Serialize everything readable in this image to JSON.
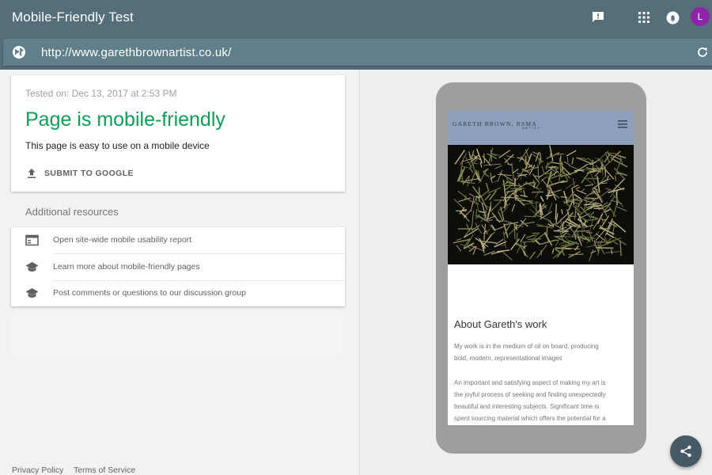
{
  "app": {
    "title": "Mobile-Friendly Test",
    "avatar_letter": "L",
    "icons": [
      "feedback-icon",
      "apps-grid-icon",
      "notifications-icon"
    ],
    "accent_color": "#546e7a",
    "success_color": "#0f9d58"
  },
  "urlbar": {
    "url": "http://www.garethbrownartist.co.uk/",
    "left_icon": "globe-icon",
    "right_icon": "refresh-icon"
  },
  "result": {
    "tested_on": "Tested on: Dec 13, 2017 at 2:53 PM",
    "verdict": "Page is mobile-friendly",
    "description": "This page is easy to use on a mobile device",
    "submit_label": "SUBMIT TO GOOGLE"
  },
  "resources": {
    "title": "Additional resources",
    "items": [
      {
        "label": "Open site-wide mobile usability report",
        "icon": "web-report-icon"
      },
      {
        "label": "Learn more about mobile-friendly pages",
        "icon": "school-icon"
      },
      {
        "label": "Post comments or questions to our discussion group",
        "icon": "school-icon"
      }
    ]
  },
  "footer": {
    "privacy": "Privacy Policy",
    "terms": "Terms of Service"
  },
  "preview": {
    "site_name": "GARETH BROWN, RSMA",
    "site_subtitle": "ARTIST",
    "about_heading": "About Gareth's work",
    "paragraph1": [
      "My work is in the medium of oil on board, producing",
      "bold, modern, representational images"
    ],
    "paragraph2": [
      "An important and satisfying aspect of making my art is",
      "the  joyful process of seeking and finding unexpectedly",
      "beautiful and interesting subjects.  Significant time is",
      "spent sourcing material which  offers the potential for a"
    ]
  },
  "share_icon": "share-icon"
}
